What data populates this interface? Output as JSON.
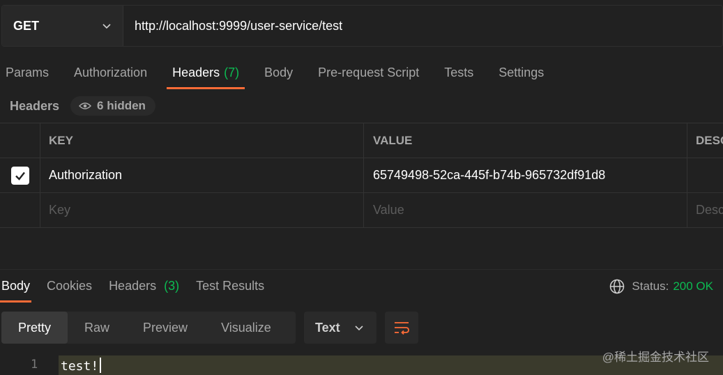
{
  "request": {
    "method": "GET",
    "url": "http://localhost:9999/user-service/test"
  },
  "request_tabs": [
    {
      "label": "Params"
    },
    {
      "label": "Authorization"
    },
    {
      "label": "Headers",
      "count": "(7)"
    },
    {
      "label": "Body"
    },
    {
      "label": "Pre-request Script"
    },
    {
      "label": "Tests"
    },
    {
      "label": "Settings"
    }
  ],
  "headers_section": {
    "title": "Headers",
    "hidden_label": "6 hidden",
    "columns": [
      "KEY",
      "VALUE",
      "DESCRIPTION"
    ],
    "rows": [
      {
        "checked": true,
        "key": "Authorization",
        "value": "65749498-52ca-445f-b74b-965732df91d8",
        "description": ""
      }
    ],
    "placeholders": {
      "key": "Key",
      "value": "Value",
      "description": "Description"
    }
  },
  "response_tabs": [
    {
      "label": "Body"
    },
    {
      "label": "Cookies"
    },
    {
      "label": "Headers",
      "count": "(3)"
    },
    {
      "label": "Test Results"
    }
  ],
  "status": {
    "label": "Status:",
    "value": "200 OK"
  },
  "view_modes": [
    "Pretty",
    "Raw",
    "Preview",
    "Visualize"
  ],
  "format": "Text",
  "editor": {
    "line_number": "1",
    "content": "test!"
  },
  "watermark": "@稀土掘金技术社区",
  "colors": {
    "accent": "#ff6c37",
    "success": "#0cbb52",
    "background": "#212121"
  }
}
